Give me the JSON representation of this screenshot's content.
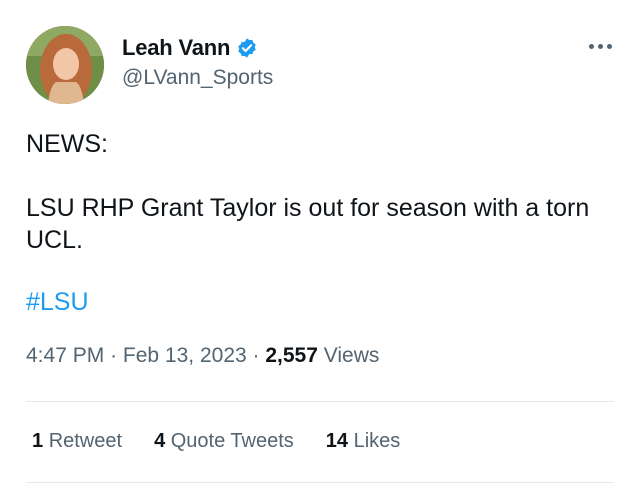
{
  "author": {
    "display_name": "Leah Vann",
    "handle": "@LVann_Sports",
    "verified": true,
    "verified_color": "#1d9bf0"
  },
  "tweet": {
    "line1": "NEWS:",
    "line2": "LSU RHP Grant Taylor is out for season with a torn UCL.",
    "hashtag": "#LSU",
    "hashtag_color": "#1d9bf0"
  },
  "meta": {
    "time": "4:47 PM",
    "separator": "·",
    "date": "Feb 13, 2023",
    "views_count": "2,557",
    "views_label": "Views"
  },
  "stats": {
    "retweets_count": "1",
    "retweets_label": "Retweet",
    "quotes_count": "4",
    "quotes_label": "Quote Tweets",
    "likes_count": "14",
    "likes_label": "Likes"
  },
  "icons": {
    "more": "more-horizontal-icon",
    "verified": "verified-badge-icon"
  }
}
